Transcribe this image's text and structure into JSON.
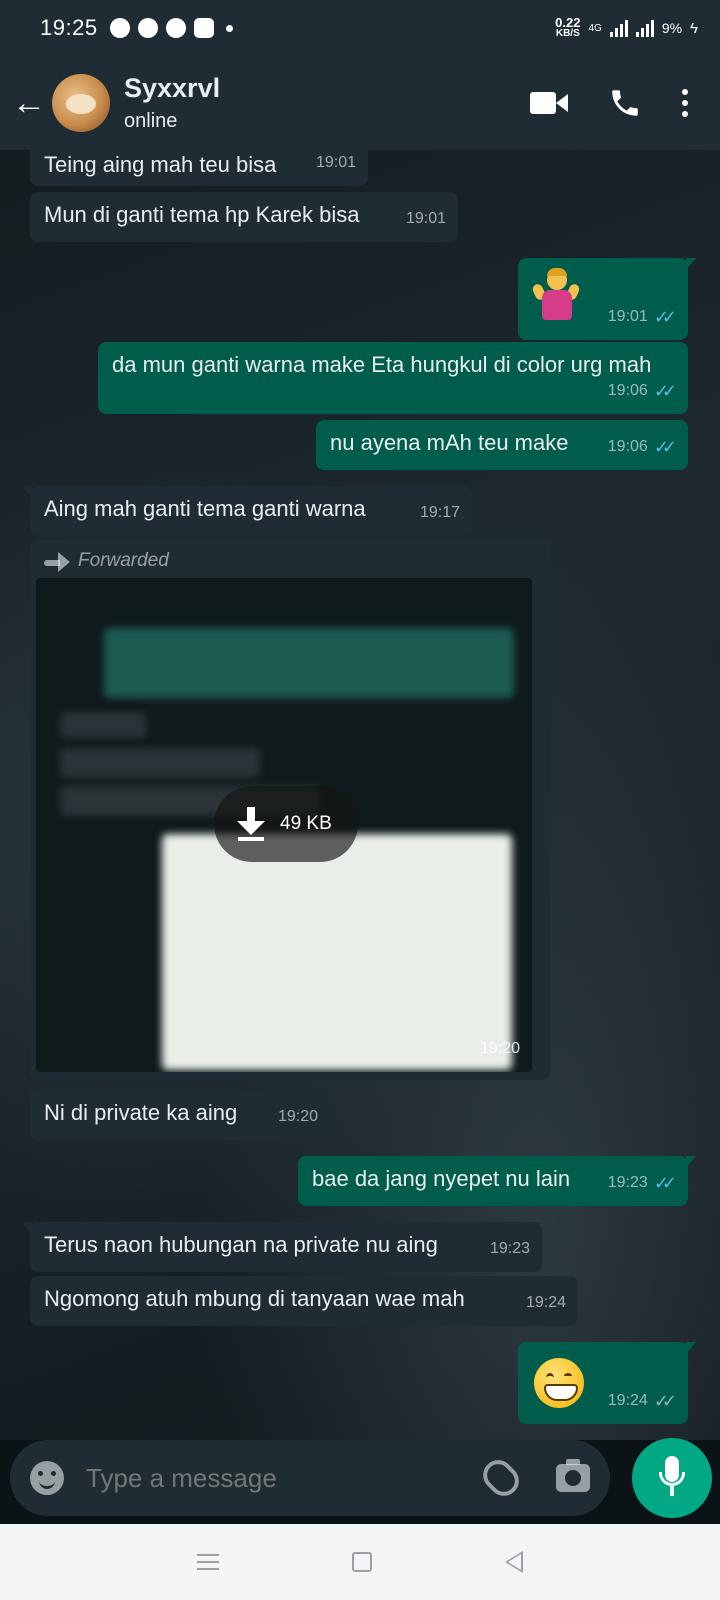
{
  "status_bar": {
    "time": "19:25",
    "speed_value": "0.22",
    "speed_unit": "KB/S",
    "network": "4G",
    "battery": "9%"
  },
  "header": {
    "contact_name": "Syxxrvl",
    "contact_status": "online"
  },
  "messages": [
    {
      "dir": "in",
      "text": "Teing aing mah teu bisa",
      "time": "19:01"
    },
    {
      "dir": "in",
      "text": "Mun di ganti tema hp Karek bisa",
      "time": "19:01"
    },
    {
      "dir": "out",
      "emoji": "person-shrugging",
      "time": "19:01",
      "read": true
    },
    {
      "dir": "out",
      "text": "da mun ganti warna make Eta hungkul di color urg mah",
      "time": "19:06",
      "read": true
    },
    {
      "dir": "out",
      "text": "nu ayena mAh teu make",
      "time": "19:06",
      "read": true
    },
    {
      "dir": "in",
      "text": "Aing mah ganti tema ganti warna",
      "time": "19:17"
    },
    {
      "dir": "in",
      "type": "image",
      "forwarded_label": "Forwarded",
      "size": "49 KB",
      "time": "19:20"
    },
    {
      "dir": "in",
      "text": "Ni di private ka aing",
      "time": "19:20"
    },
    {
      "dir": "out",
      "text": "bae da jang nyepet nu lain",
      "time": "19:23",
      "read": true
    },
    {
      "dir": "in",
      "text": "Terus naon hubungan na private nu aing",
      "time": "19:23"
    },
    {
      "dir": "in",
      "text": "Ngomong atuh mbung di tanyaan wae mah",
      "time": "19:24"
    },
    {
      "dir": "out",
      "emoji": "grinning-face",
      "time": "19:24",
      "read": false
    }
  ],
  "composer": {
    "placeholder": "Type a message"
  },
  "colors": {
    "header_bg": "#1f2c34",
    "incoming_bubble": "#202c33",
    "outgoing_bubble": "#005c4b",
    "read_ticks": "#53bdeb",
    "mic_button": "#00a884"
  },
  "ticks_glyph": "✓✓"
}
